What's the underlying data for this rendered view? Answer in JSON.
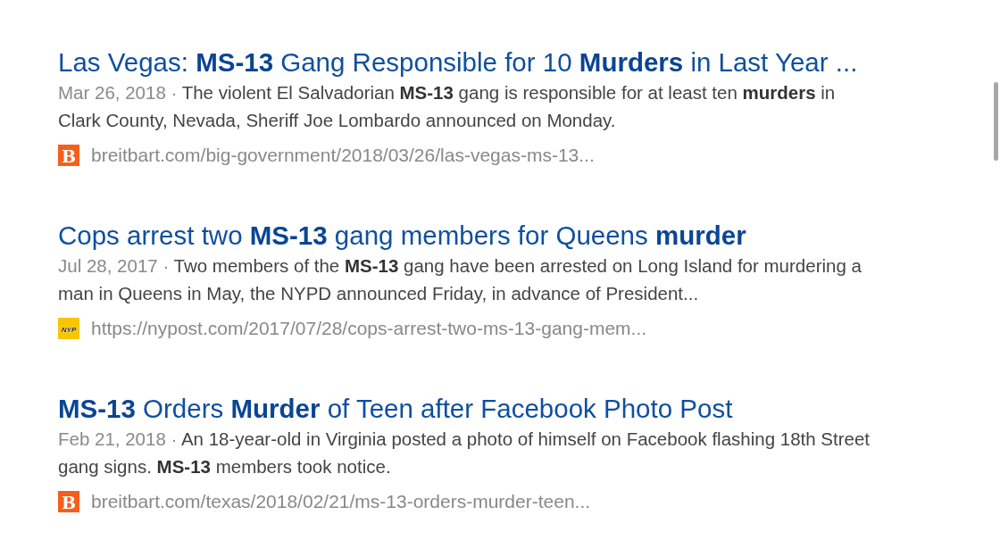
{
  "results": [
    {
      "title": "Las Vegas: **MS-13** Gang Responsible for 10 **Murders** in Last Year ...",
      "date": "Mar 26, 2018 ·",
      "snippet": "The violent El Salvadorian **MS-13** gang is responsible for at least ten **murders** in Clark County, Nevada, Sheriff Joe Lombardo announced on Monday.",
      "favicon": {
        "kind": "letter",
        "text": "B",
        "color": "#f4601c"
      },
      "url": "breitbart.com/big-government/2018/03/26/las-vegas-ms-13..."
    },
    {
      "title": "Cops arrest two **MS-13** gang members for Queens **murder**",
      "date": "Jul 28, 2017 ·",
      "snippet": "Two members of the **MS-13** gang have been arrested on Long Island for murdering a man in Queens in May, the NYPD announced Friday, in advance of President...",
      "favicon": {
        "kind": "wordmark",
        "text": "NYP",
        "color": "#f7c600"
      },
      "url": "https://nypost.com/2017/07/28/cops-arrest-two-ms-13-gang-mem..."
    },
    {
      "title": "**MS-13** Orders **Murder** of Teen after Facebook Photo Post",
      "date": "Feb 21, 2018 ·",
      "snippet": "An 18-year-old in Virginia posted a photo of himself on Facebook flashing 18th Street gang signs. **MS-13** members took notice.",
      "favicon": {
        "kind": "letter",
        "text": "B",
        "color": "#f4601c"
      },
      "url": "breitbart.com/texas/2018/02/21/ms-13-orders-murder-teen..."
    }
  ]
}
